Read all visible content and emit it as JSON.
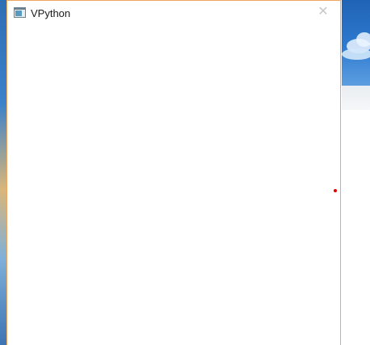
{
  "window": {
    "title": "VPython",
    "close_glyph": "✕",
    "accent_border_color": "#f0a660"
  },
  "icons": {
    "app": "vpython-app-icon",
    "close": "close-icon"
  },
  "scene": {
    "background": "#ffffff",
    "object": "red-sphere-marker",
    "object_color": "#e00000"
  }
}
